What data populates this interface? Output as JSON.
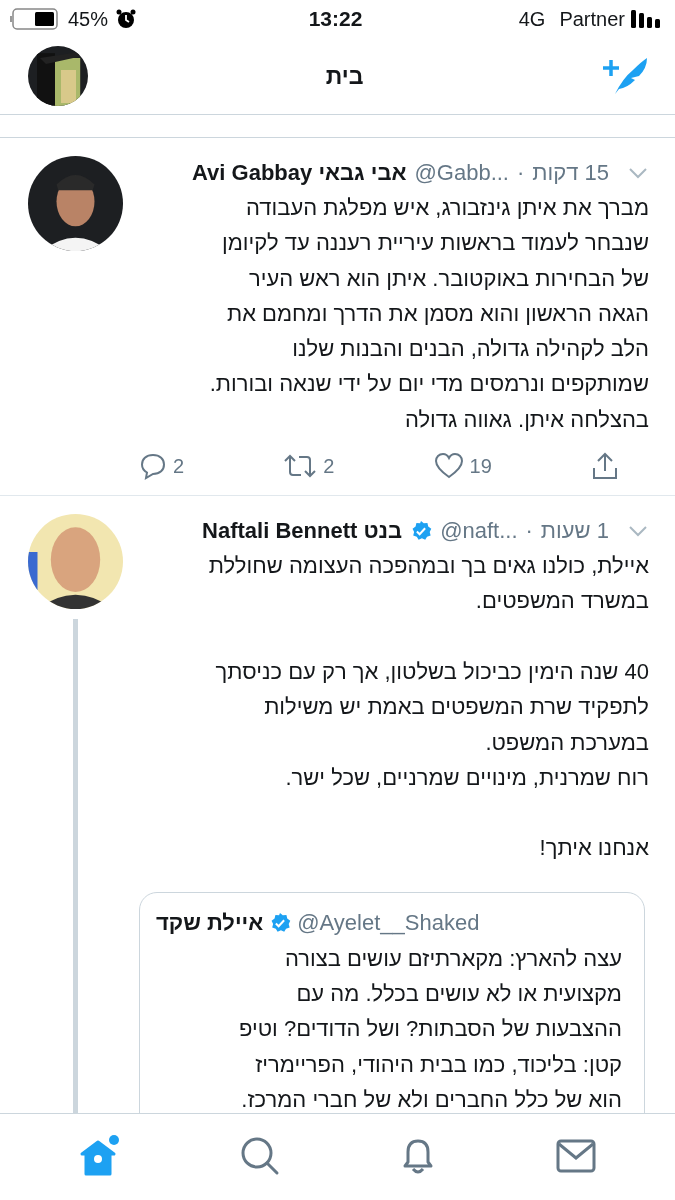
{
  "status_bar": {
    "battery": "45%",
    "time": "13:22",
    "network": "4G",
    "carrier": "Partner"
  },
  "header": {
    "title": "בית"
  },
  "tweets": [
    {
      "name": "Avi Gabbay אבי גבאי",
      "verified": false,
      "handle": "@Gabb...",
      "separator": "·",
      "time": "15 דקות",
      "text": "מברך את איתן גינזבורג, איש מפלגת העבודה\nשנבחר לעמוד בראשות עיריית רעננה עד לקיומן\nשל הבחירות באוקטובר. איתן הוא ראש העיר\nהגאה הראשון והוא מסמן את הדרך ומחמם את\nהלב לקהילה גדולה, הבנים והבנות שלנו\nשמותקפים ונרמסים מדי יום על ידי שנאה ובורות.\nבהצלחה איתן. גאווה גדולה",
      "thread": false,
      "actions": {
        "replies": "2",
        "retweets": "2",
        "likes": "19"
      }
    },
    {
      "name": "Naftali Bennett בנט",
      "verified": true,
      "handle": "@naft...",
      "separator": "·",
      "time": "1 שעות",
      "text": "איילת, כולנו גאים בך ובמהפכה העצומה שחוללת\nבמשרד המשפטים.\n\n40 שנה הימין כביכול בשלטון, אך רק עם כניסתך\nלתפקיד שרת המשפטים באמת יש משילות\nבמערכת המשפט.\nרוח שמרנית, מינויים שמרניים, שכל ישר.\n\nאנחנו איתך!",
      "thread": true,
      "quote": {
        "name": "איילת שקד",
        "verified": true,
        "handle": "@Ayelet__Shaked",
        "text": "עצה להארץ: מקארתיזם עושים בצורה\nמקצועית או לא עושים בכלל. מה עם\nההצבעות של הסבתות? ושל הדודים? וטיפ\nקטן: בליכוד, כמו בבית היהודי, הפריימריז\nהוא של כלל החברים ולא של חברי המרכז."
      }
    }
  ],
  "tabs": [
    {
      "kind": "home",
      "selected": true,
      "badge": true
    },
    {
      "kind": "search",
      "selected": false
    },
    {
      "kind": "notifications",
      "selected": false
    },
    {
      "kind": "messages",
      "selected": false
    }
  ]
}
